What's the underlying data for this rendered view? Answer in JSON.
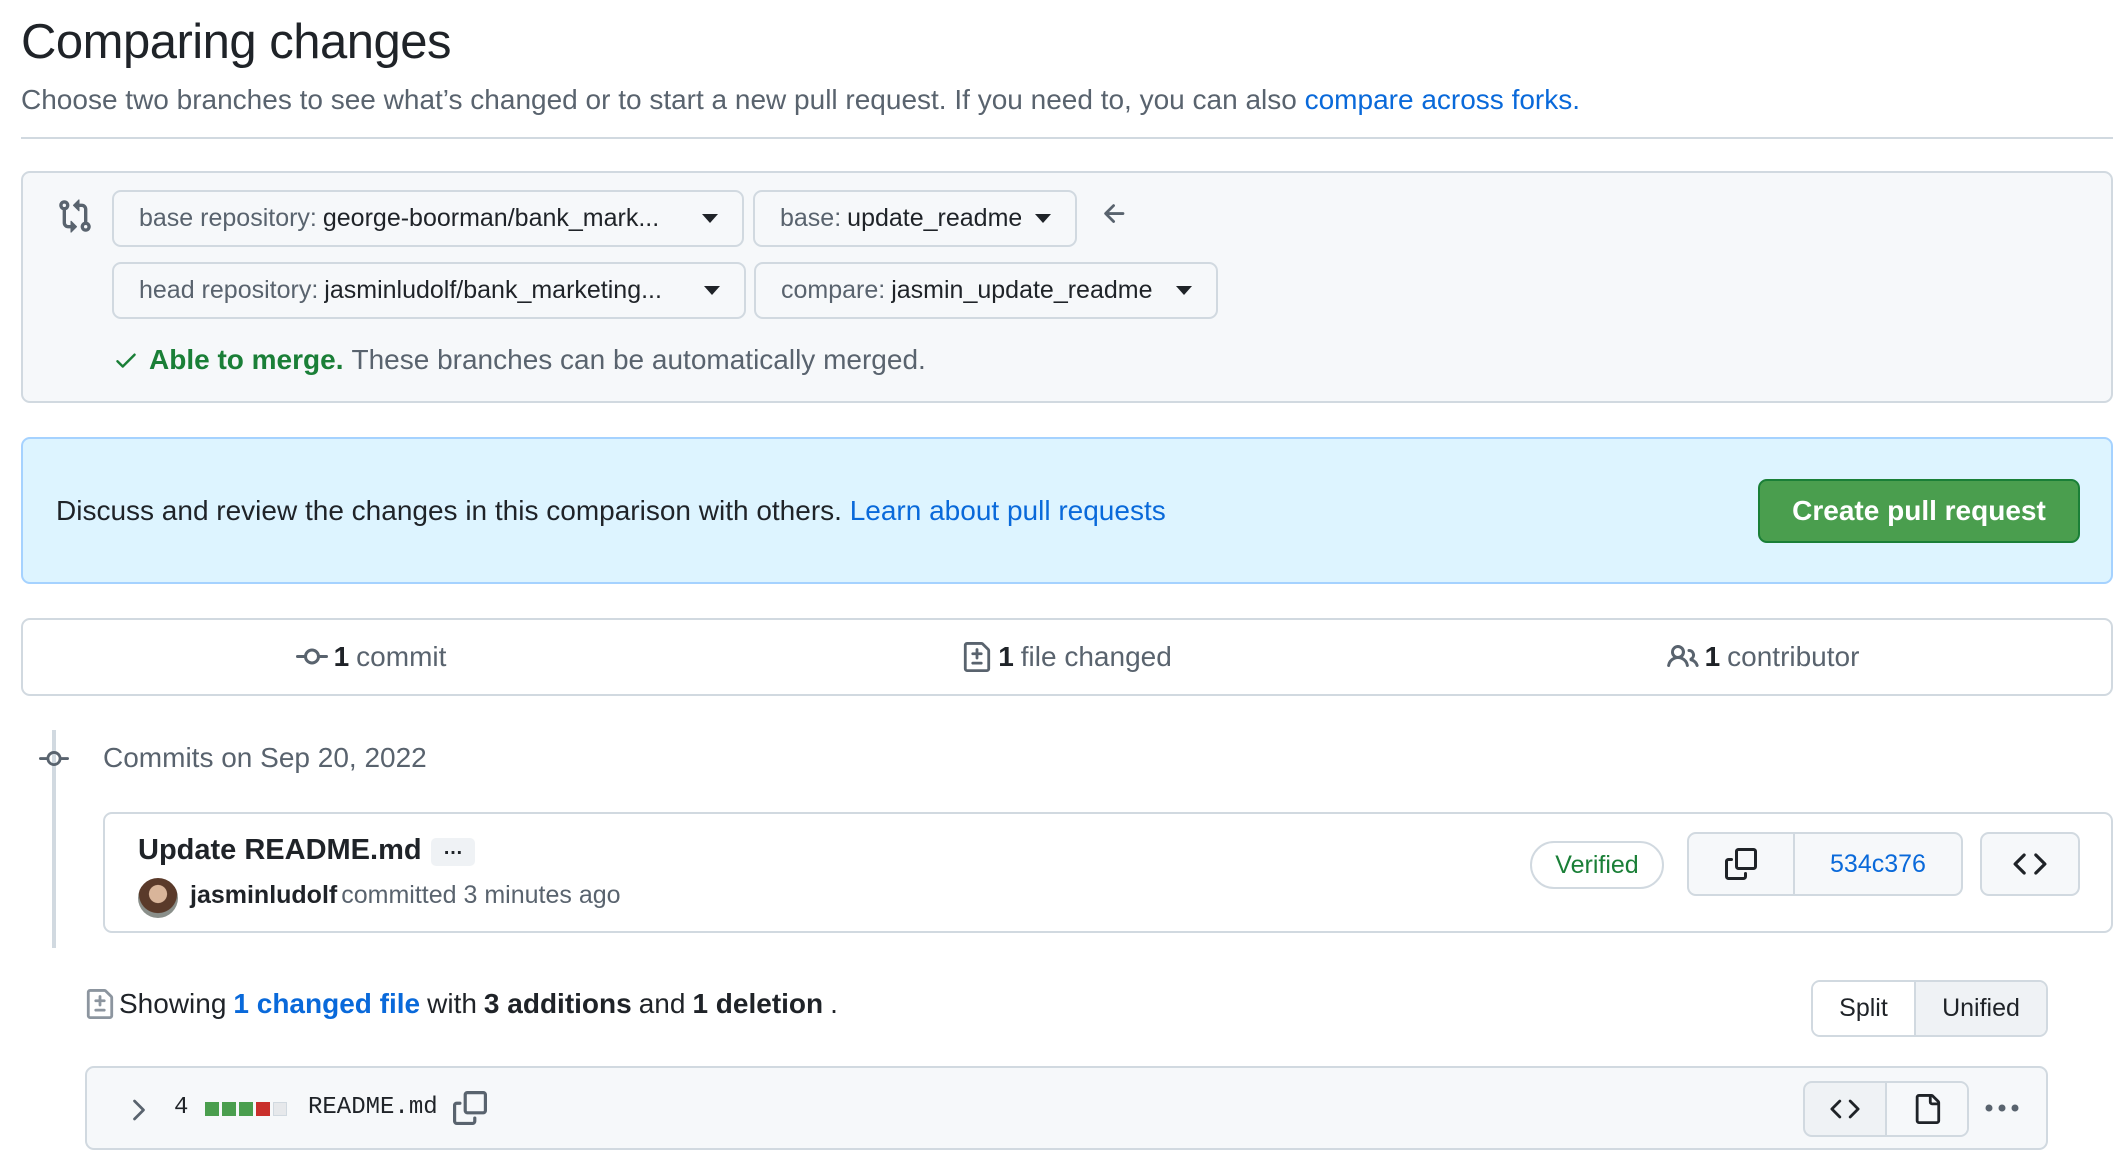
{
  "page": {
    "title": "Comparing changes",
    "subtitle_text": "Choose two branches to see what’s changed or to start a new pull request. If you need to, you can also ",
    "subtitle_link": "compare across forks."
  },
  "range": {
    "base_repo_label": "base repository:",
    "base_repo_value": "george-boorman/bank_mark...",
    "base_label": "base:",
    "base_value": "update_readme",
    "head_repo_label": "head repository:",
    "head_repo_value": "jasminludolf/bank_marketing...",
    "compare_label": "compare:",
    "compare_value": "jasmin_update_readme",
    "merge_ok": "Able to merge.",
    "merge_text": "These branches can be automatically merged."
  },
  "flash": {
    "text": "Discuss and review the changes in this comparison with others. ",
    "link": "Learn about pull requests",
    "button": "Create pull request"
  },
  "stats": {
    "commits_count": "1",
    "commits_label": "commit",
    "files_count": "1",
    "files_label": "file changed",
    "contributors_count": "1",
    "contributors_label": "contributor"
  },
  "commits": {
    "date_heading": "Commits on Sep 20, 2022",
    "items": [
      {
        "title": "Update README.md",
        "ellipsis": "…",
        "author": "jasminludolf",
        "meta": "committed 3 minutes ago",
        "verified": "Verified",
        "sha": "534c376"
      }
    ]
  },
  "diff_summary": {
    "prefix": "Showing",
    "files_link": "1 changed file",
    "with": "with",
    "additions": "3 additions",
    "and": "and",
    "deletions": "1 deletion",
    "suffix": ".",
    "split": "Split",
    "unified": "Unified"
  },
  "file": {
    "changes": "4",
    "name": "README.md",
    "diffstat": [
      "added",
      "added",
      "added",
      "deleted",
      "neutral"
    ]
  },
  "colors": {
    "accent": "#0969da",
    "success": "#1a7f37",
    "button_green": "#4a9e4e",
    "flash_bg": "#ddf4ff",
    "diff_added": "#4a9e4e",
    "diff_deleted": "#c9302c",
    "diff_neutral": "#e6e8eb"
  }
}
